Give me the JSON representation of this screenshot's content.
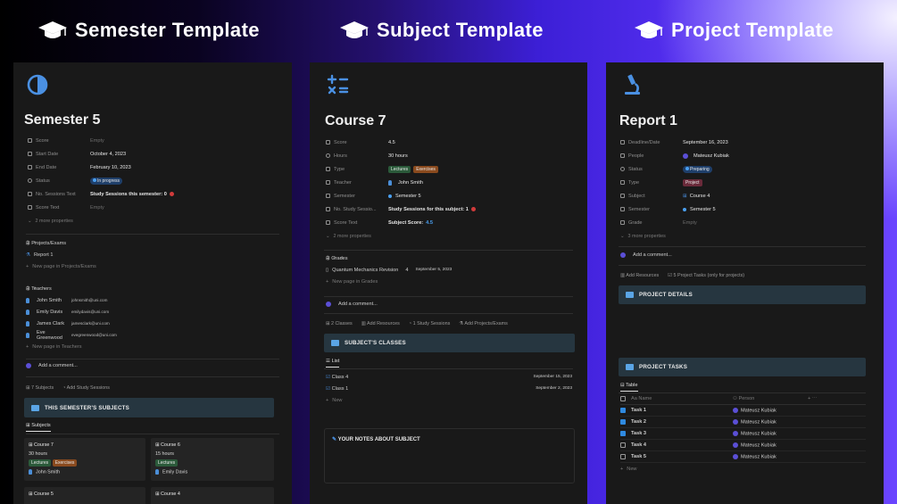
{
  "titles": {
    "semester": "Semester Template",
    "subject": "Subject Template",
    "project": "Project Template"
  },
  "semester": {
    "title": "Semester 5",
    "props": [
      {
        "k": "Score",
        "v": "Empty"
      },
      {
        "k": "Start Date",
        "v": "October 4, 2023"
      },
      {
        "k": "End Date",
        "v": "February 10, 2023"
      },
      {
        "k": "Status",
        "v": "In progress"
      },
      {
        "k": "No. Sessions Text",
        "v": "Study Sessions this semester: 0"
      },
      {
        "k": "Score Text",
        "v": "Empty"
      }
    ],
    "more": "2 more properties",
    "projects_label": "Projects/Exams",
    "project_item": "Report 1",
    "project_new": "New page in Projects/Exams",
    "teachers_label": "Teachers",
    "teachers": [
      {
        "name": "John Smith",
        "email": "johnsmith@uni.com"
      },
      {
        "name": "Emily Davis",
        "email": "emilydavis@uni.com"
      },
      {
        "name": "James Clark",
        "email": "jamesclark@uni.com"
      },
      {
        "name": "Eve Greenwood",
        "email": "evegreenwood@uni.com"
      }
    ],
    "teachers_new": "New page in Teachers",
    "comment": "Add a comment...",
    "subjects_count": "7 Subjects",
    "add_sessions": "Add Study Sessions",
    "banner": "THIS SEMESTER'S SUBJECTS",
    "tab": "Subjects",
    "cards": [
      {
        "title": "Course 7",
        "hours": "30 hours",
        "tags": [
          "Lectures",
          "Exercises"
        ],
        "teacher": "John Smith"
      },
      {
        "title": "Course 6",
        "hours": "15 hours",
        "tags": [
          "Lectures"
        ],
        "teacher": "Emily Davis"
      },
      {
        "title": "Course 5"
      },
      {
        "title": "Course 4"
      }
    ]
  },
  "subject": {
    "title": "Course 7",
    "props": [
      {
        "k": "Score",
        "v": "4.5"
      },
      {
        "k": "Hours",
        "v": "30 hours"
      },
      {
        "k": "Type",
        "tags": [
          "Lectures",
          "Exercises"
        ]
      },
      {
        "k": "Teacher",
        "v": "John Smith"
      },
      {
        "k": "Semester",
        "v": "Semester 5"
      },
      {
        "k": "No. Study Sessio...",
        "v": "Study Sessions for this subject: 1"
      },
      {
        "k": "Score Text",
        "v": "Subject Score: ",
        "v2": "4.5"
      }
    ],
    "more": "2 more properties",
    "grades_label": "Grades",
    "grade_item": {
      "name": "Quantum Mechanics Revision",
      "score": "4",
      "date": "September 5, 2023"
    },
    "grades_new": "New page in Grades",
    "comment": "Add a comment...",
    "actions": [
      "2 Classes",
      "Add Resources",
      "1 Study Sessions",
      "Add Projects/Exams"
    ],
    "banner": "SUBJECT'S CLASSES",
    "tab": "List",
    "classes": [
      {
        "name": "Class 4",
        "date": "September 15, 2023"
      },
      {
        "name": "Class 1",
        "date": "September 2, 2023"
      }
    ],
    "new": "New",
    "notes": "YOUR NOTES ABOUT SUBJECT"
  },
  "project": {
    "title": "Report 1",
    "props": [
      {
        "k": "Deadline/Date",
        "v": "September 16, 2023"
      },
      {
        "k": "People",
        "v": "Mateusz Kubiak"
      },
      {
        "k": "Status",
        "v": "Preparing"
      },
      {
        "k": "Type",
        "v": "Project"
      },
      {
        "k": "Subject",
        "v": "Course 4"
      },
      {
        "k": "Semester",
        "v": "Semester 5"
      },
      {
        "k": "Grade",
        "v": "Empty"
      }
    ],
    "more": "3 more properties",
    "comment": "Add a comment...",
    "actions": [
      "Add Resources",
      "5 Project Tasks (only for projects)"
    ],
    "banner1": "PROJECT DETAILS",
    "banner2": "PROJECT TASKS",
    "tab": "Table",
    "col_name": "Name",
    "col_person": "Person",
    "tasks": [
      {
        "name": "Task 1",
        "done": true,
        "person": "Mateusz Kubiak"
      },
      {
        "name": "Task 2",
        "done": true,
        "person": "Mateusz Kubiak"
      },
      {
        "name": "Task 3",
        "done": true,
        "person": "Mateusz Kubiak"
      },
      {
        "name": "Task 4",
        "done": false,
        "person": "Mateusz Kubiak"
      },
      {
        "name": "Task 5",
        "done": false,
        "person": "Mateusz Kubiak"
      }
    ],
    "new": "New"
  }
}
